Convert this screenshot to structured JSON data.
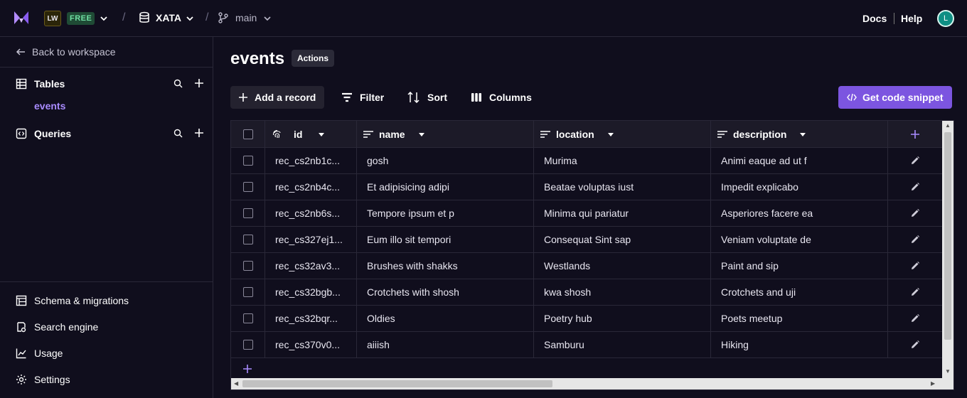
{
  "topbar": {
    "workspace_badge": "LW",
    "plan_badge": "FREE",
    "database": "XATA",
    "branch": "main",
    "docs": "Docs",
    "help": "Help",
    "avatar_initial": "L"
  },
  "sidebar": {
    "back": "Back to workspace",
    "tables_label": "Tables",
    "active_table": "events",
    "queries_label": "Queries",
    "bottom": [
      "Schema & migrations",
      "Search engine",
      "Usage",
      "Settings"
    ]
  },
  "main": {
    "title": "events",
    "actions": "Actions",
    "toolbar": {
      "add_record": "Add a record",
      "filter": "Filter",
      "sort": "Sort",
      "columns": "Columns",
      "snippet": "Get code snippet"
    }
  },
  "table": {
    "columns": [
      "id",
      "name",
      "location",
      "description"
    ],
    "rows": [
      [
        "rec_cs2nb1c...",
        "gosh",
        "Murima",
        "Animi eaque ad ut f"
      ],
      [
        "rec_cs2nb4c...",
        "Et adipisicing adipi",
        "Beatae voluptas iust",
        "Impedit explicabo"
      ],
      [
        "rec_cs2nb6s...",
        "Tempore ipsum et p",
        "Minima qui pariatur",
        "Asperiores facere ea"
      ],
      [
        "rec_cs327ej1...",
        "Eum illo sit tempori",
        "Consequat Sint sap",
        "Veniam voluptate de"
      ],
      [
        "rec_cs32av3...",
        "Brushes with shakks",
        "Westlands",
        "Paint and sip"
      ],
      [
        "rec_cs32bgb...",
        "Crotchets with shosh",
        "kwa shosh",
        "Crotchets and uji"
      ],
      [
        "rec_cs32bqr...",
        "Oldies",
        "Poetry hub",
        "Poets meetup"
      ],
      [
        "rec_cs370v0...",
        "aiiish",
        "Samburu",
        "Hiking"
      ]
    ]
  },
  "colors": {
    "accent": "#7c55e0",
    "active_link": "#a98bff",
    "background": "#100e1d"
  }
}
